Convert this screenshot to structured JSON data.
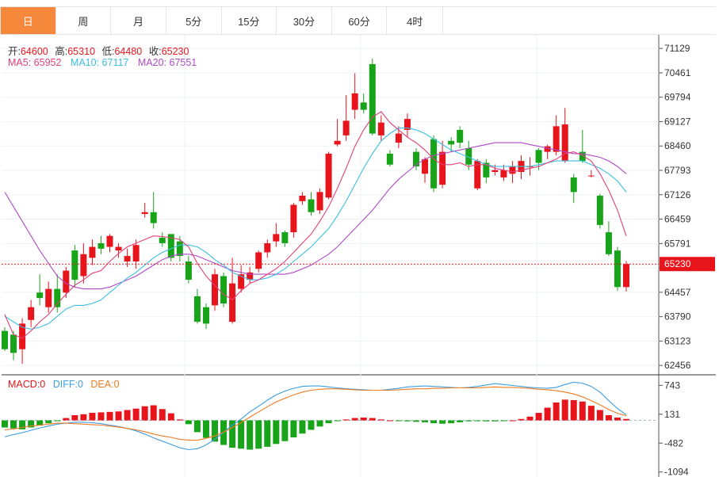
{
  "tabs": [
    "日",
    "周",
    "月",
    "5分",
    "15分",
    "30分",
    "60分",
    "4时"
  ],
  "active_tab": 0,
  "ohlc": {
    "open_label": "开:",
    "open": "64600",
    "high_label": "高:",
    "high": "65310",
    "low_label": "低:",
    "low": "64480",
    "close_label": "收:",
    "close": "65230"
  },
  "ma": {
    "ma5_label": "MA5:",
    "ma5": "65952",
    "ma10_label": "MA10:",
    "ma10": "67117",
    "ma20_label": "MA20:",
    "ma20": "67551"
  },
  "macd": {
    "macd_label": "MACD:",
    "macd": "0",
    "diff_label": "DIFF:",
    "diff": "0",
    "dea_label": "DEA:",
    "dea": "0"
  },
  "colors": {
    "up": "#e8141b",
    "down": "#18a418",
    "ma5": "#e0407a",
    "ma10": "#3bbfe0",
    "ma20": "#b04ac8",
    "dea": "#f07a20",
    "diff": "#3b9ee0",
    "accent": "#f5883b"
  },
  "chart_data": [
    {
      "type": "candlestick",
      "price_axis_ticks": [
        "71129",
        "70461",
        "69794",
        "69127",
        "68460",
        "67793",
        "67126",
        "66459",
        "65791",
        "65124",
        "64457",
        "63790",
        "63123",
        "62456"
      ],
      "last_price_label": "65230",
      "ylim": [
        62200,
        71500
      ],
      "candles": [
        [
          63400,
          62900,
          63500,
          62850
        ],
        [
          63300,
          62800,
          63400,
          62600
        ],
        [
          62900,
          63600,
          63750,
          62500
        ],
        [
          63700,
          64050,
          64250,
          63500
        ],
        [
          64450,
          64300,
          64950,
          64100
        ],
        [
          64050,
          64550,
          64750,
          63900
        ],
        [
          64550,
          64050,
          64950,
          63900
        ],
        [
          64450,
          65050,
          65150,
          64300
        ],
        [
          65600,
          64800,
          65750,
          64600
        ],
        [
          64900,
          65500,
          65800,
          64700
        ],
        [
          65400,
          65700,
          65900,
          65200
        ],
        [
          65800,
          65650,
          66000,
          65500
        ],
        [
          65700,
          66000,
          66050,
          65550
        ],
        [
          65600,
          65700,
          65800,
          65400
        ],
        [
          65300,
          65450,
          65650,
          65150
        ],
        [
          65300,
          65750,
          65900,
          65100
        ],
        [
          66600,
          66650,
          66900,
          66500
        ],
        [
          66650,
          66350,
          67200,
          66200
        ],
        [
          65950,
          65800,
          66100,
          65700
        ],
        [
          66050,
          65400,
          66050,
          65300
        ],
        [
          65850,
          65450,
          66000,
          65300
        ],
        [
          65300,
          64800,
          65450,
          64700
        ],
        [
          64350,
          63650,
          64550,
          63600
        ],
        [
          64050,
          63600,
          64150,
          63450
        ],
        [
          64100,
          64950,
          65100,
          63950
        ],
        [
          64900,
          64150,
          65000,
          64050
        ],
        [
          63650,
          64700,
          65400,
          63600
        ],
        [
          64550,
          64950,
          65200,
          64450
        ],
        [
          64800,
          65000,
          65150,
          64700
        ],
        [
          65100,
          65550,
          65600,
          65000
        ],
        [
          65550,
          65800,
          65900,
          65400
        ],
        [
          65850,
          66050,
          66350,
          65700
        ],
        [
          66100,
          65800,
          66150,
          65700
        ],
        [
          66100,
          66850,
          66900,
          65950
        ],
        [
          66950,
          67100,
          67200,
          66850
        ],
        [
          67000,
          66650,
          67200,
          66550
        ],
        [
          66700,
          67200,
          67300,
          66600
        ],
        [
          67050,
          68250,
          68300,
          67000
        ],
        [
          68500,
          68600,
          69200,
          68450
        ],
        [
          68750,
          69150,
          69850,
          68600
        ],
        [
          69450,
          69900,
          70450,
          69200
        ],
        [
          69650,
          69450,
          69900,
          69350
        ],
        [
          70700,
          68800,
          70850,
          68750
        ],
        [
          68750,
          69100,
          69300,
          68600
        ],
        [
          68250,
          67950,
          68350,
          67900
        ],
        [
          68550,
          68800,
          69000,
          68400
        ],
        [
          68900,
          69200,
          69350,
          68700
        ],
        [
          68300,
          67900,
          68400,
          67800
        ],
        [
          67700,
          68100,
          68150,
          67450
        ],
        [
          68650,
          67300,
          68750,
          67200
        ],
        [
          67400,
          68300,
          68600,
          67300
        ],
        [
          68600,
          68500,
          68700,
          68300
        ],
        [
          68900,
          68550,
          69000,
          68400
        ],
        [
          68400,
          67950,
          68600,
          67800
        ],
        [
          67300,
          68050,
          68100,
          67250
        ],
        [
          68000,
          67600,
          68100,
          67450
        ],
        [
          67750,
          67800,
          67950,
          67650
        ],
        [
          67600,
          67800,
          67950,
          67500
        ],
        [
          67700,
          67900,
          68050,
          67450
        ],
        [
          67750,
          68050,
          68200,
          67550
        ],
        [
          67900,
          67900,
          68150,
          67650
        ],
        [
          68350,
          68000,
          68400,
          67800
        ],
        [
          68300,
          68450,
          68500,
          68100
        ],
        [
          68300,
          69000,
          69300,
          68200
        ],
        [
          68050,
          69050,
          69500,
          68000
        ],
        [
          67600,
          67200,
          67700,
          66900
        ],
        [
          68300,
          68050,
          68900,
          68000
        ],
        [
          67650,
          67650,
          67800,
          67600
        ],
        [
          67100,
          66300,
          67150,
          66200
        ],
        [
          66100,
          65500,
          66400,
          65450
        ],
        [
          65600,
          64600,
          65700,
          64500
        ],
        [
          64600,
          65230,
          65310,
          64480
        ]
      ],
      "ma5": [
        63850,
        63300,
        63200,
        63400,
        63650,
        63850,
        64150,
        64400,
        64650,
        64800,
        64980,
        65050,
        65300,
        65520,
        65700,
        65800,
        65900,
        66000,
        65980,
        65950,
        65900,
        65700,
        65250,
        64900,
        64650,
        64400,
        64250,
        64500,
        64700,
        64800,
        64950,
        65100,
        65300,
        65550,
        65800,
        66050,
        66400,
        66800,
        67300,
        67850,
        68450,
        68900,
        69250,
        69400,
        69100,
        68900,
        68700,
        68550,
        68350,
        68100,
        67950,
        67950,
        68000,
        67900,
        67950,
        67950,
        67850,
        67800,
        67750,
        67800,
        67850,
        67900,
        68000,
        68100,
        68250,
        68300,
        68200,
        68050,
        67700,
        67250,
        66700,
        66000
      ],
      "ma10": [
        63800,
        63650,
        63500,
        63450,
        63500,
        63600,
        63800,
        64000,
        64100,
        64100,
        64150,
        64250,
        64450,
        64650,
        64850,
        65000,
        65200,
        65400,
        65550,
        65650,
        65750,
        65750,
        65700,
        65550,
        65350,
        65200,
        65000,
        64900,
        64800,
        64800,
        64850,
        64950,
        65100,
        65300,
        65500,
        65700,
        65950,
        66200,
        66550,
        66950,
        67400,
        67850,
        68250,
        68600,
        68800,
        68950,
        68950,
        68900,
        68800,
        68650,
        68500,
        68350,
        68250,
        68150,
        68050,
        67950,
        67900,
        67900,
        67900,
        67900,
        67900,
        67950,
        68000,
        68050,
        68050,
        68050,
        68050,
        67950,
        67850,
        67700,
        67500,
        67200
      ],
      "ma20": [
        67200,
        66800,
        66400,
        66000,
        65600,
        65250,
        64900,
        64700,
        64600,
        64550,
        64550,
        64550,
        64600,
        64700,
        64800,
        64900,
        65050,
        65200,
        65350,
        65450,
        65500,
        65500,
        65450,
        65350,
        65250,
        65150,
        65050,
        65000,
        64950,
        64950,
        64950,
        64950,
        64950,
        65000,
        65100,
        65200,
        65350,
        65500,
        65700,
        65950,
        66200,
        66450,
        66700,
        67000,
        67300,
        67550,
        67750,
        67950,
        68100,
        68200,
        68250,
        68300,
        68350,
        68400,
        68450,
        68500,
        68550,
        68550,
        68550,
        68550,
        68500,
        68450,
        68400,
        68350,
        68300,
        68250,
        68250,
        68200,
        68150,
        68050,
        67900,
        67700
      ],
      "macd_axis_ticks": [
        "743",
        "131",
        "-482",
        "-1094"
      ],
      "macd_ylim": [
        -1200,
        950
      ],
      "macd_hist": [
        -150,
        -170,
        -190,
        -150,
        -110,
        -60,
        -10,
        50,
        110,
        130,
        160,
        170,
        180,
        190,
        220,
        250,
        300,
        320,
        240,
        150,
        20,
        -80,
        -250,
        -370,
        -450,
        -520,
        -580,
        -600,
        -620,
        -600,
        -560,
        -500,
        -440,
        -360,
        -280,
        -200,
        -130,
        -60,
        -10,
        20,
        50,
        60,
        50,
        20,
        0,
        -10,
        -20,
        -30,
        -40,
        -60,
        -70,
        -60,
        -40,
        -20,
        -10,
        -20,
        -20,
        -10,
        0,
        30,
        80,
        160,
        270,
        380,
        440,
        430,
        400,
        310,
        220,
        110,
        60,
        30
      ],
      "dea": [
        -200,
        -180,
        -150,
        -120,
        -100,
        -80,
        -60,
        -60,
        -70,
        -80,
        -90,
        -100,
        -120,
        -140,
        -170,
        -200,
        -240,
        -290,
        -330,
        -360,
        -400,
        -420,
        -420,
        -380,
        -330,
        -250,
        -150,
        -50,
        70,
        180,
        290,
        390,
        470,
        540,
        600,
        640,
        660,
        670,
        670,
        660,
        650,
        640,
        640,
        640,
        640,
        650,
        660,
        670,
        670,
        680,
        680,
        690,
        690,
        690,
        690,
        700,
        710,
        700,
        700,
        690,
        680,
        660,
        650,
        630,
        600,
        560,
        500,
        420,
        330,
        230,
        150,
        100
      ],
      "diff": [
        -350,
        -300,
        -260,
        -210,
        -160,
        -120,
        -80,
        -60,
        -40,
        -40,
        -50,
        -70,
        -100,
        -130,
        -170,
        -220,
        -290,
        -370,
        -440,
        -510,
        -580,
        -620,
        -600,
        -520,
        -400,
        -250,
        -100,
        30,
        180,
        300,
        430,
        540,
        620,
        680,
        720,
        730,
        730,
        710,
        690,
        670,
        660,
        650,
        640,
        640,
        660,
        680,
        710,
        720,
        730,
        720,
        710,
        700,
        690,
        700,
        720,
        750,
        780,
        760,
        740,
        720,
        700,
        690,
        680,
        700,
        760,
        810,
        790,
        720,
        600,
        420,
        250,
        120
      ]
    }
  ]
}
